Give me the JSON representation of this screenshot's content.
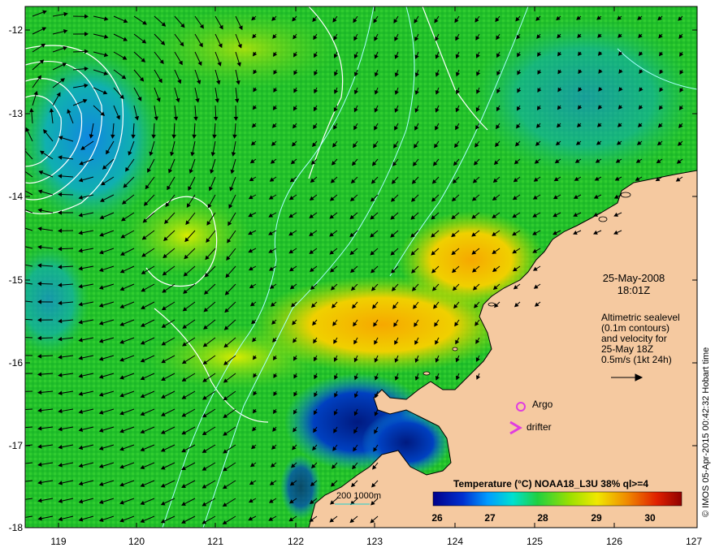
{
  "map": {
    "date": "25-May-2008",
    "time": "18:01Z",
    "altimetry_note_lines": [
      "Altimetric sealevel",
      "(0.1m contours)",
      "and velocity for",
      "25-May 18Z"
    ],
    "scale_vector_label": "0.5m/s (1kt 24h)",
    "argo_label": "Argo",
    "drifter_label": "drifter",
    "bathymetry_label": "200  1000m",
    "credit": "© IMOS 05-Apr-2015 00:42:32 Hobart time",
    "colorbar": {
      "title": "Temperature (°C) NOAA18_L3U 38% ql>=4",
      "ticks": [
        "26",
        "27",
        "28",
        "29",
        "30"
      ],
      "range": [
        26,
        30.7
      ]
    },
    "y_axis_ticks": [
      "-12",
      "-13",
      "-14",
      "-15",
      "-16",
      "-17",
      "-18"
    ],
    "x_axis_ticks": [
      "119",
      "120",
      "121",
      "122",
      "123",
      "124",
      "125",
      "126",
      "127"
    ],
    "colors": {
      "land": "#f5c9a0",
      "sea_dominant": "#26c826",
      "warm_patch": "#f2b800",
      "cold_patch": "#0a2a9a",
      "argo_marker": "#e03ce0",
      "contour": "#a8ffff",
      "sealevel_contour": "#ffffff"
    }
  }
}
